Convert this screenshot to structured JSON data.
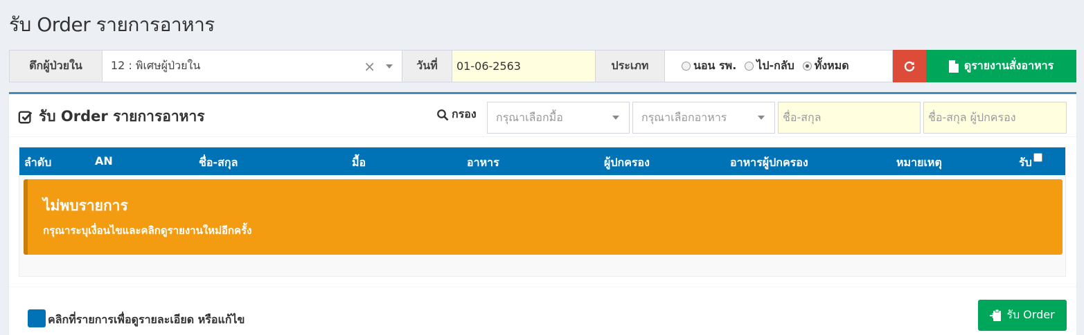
{
  "page": {
    "title": "รับ Order รายการอาหาร"
  },
  "filters": {
    "ward_label": "ตึกผู้ป่วยใน",
    "ward_value": "12 : พิเศษผู้ป่วยใน",
    "clear_symbol": "×",
    "date_label": "วันที่",
    "date_value": "01-06-2563",
    "type_label": "ประเภท",
    "type_options": [
      {
        "label": "นอน รพ.",
        "checked": false
      },
      {
        "label": "ไป-กลับ",
        "checked": false
      },
      {
        "label": "ทั้งหมด",
        "checked": true
      }
    ],
    "refresh_icon": "refresh-icon",
    "report_button": "ดูรายงานสั่งอาหาร"
  },
  "box": {
    "title": "รับ Order รายการอาหาร",
    "filter_label": "กรอง",
    "meal_placeholder": "กรุณาเลือกมื้อ",
    "food_placeholder": "กรุณาเลือกอาหาร",
    "name_placeholder": "ชื่อ-สกุล",
    "guardian_placeholder": "ชื่อ-สกุล ผู้ปกครอง"
  },
  "table": {
    "columns": [
      "ลำดับ",
      "AN",
      "ชื่อ-สกุล",
      "มื้อ",
      "อาหาร",
      "ผู้ปกครอง",
      "อาหารผู้ปกครอง",
      "หมายเหตุ",
      "รับ"
    ]
  },
  "alert": {
    "title": "ไม่พบรายการ",
    "text": "กรุณาระบุเงื่อนไขและคลิกดูรายงานใหม่อีกครั้ง"
  },
  "footer": {
    "legend": "คลิกที่รายการเพื่อดูรายละเอียด หรือแก้ไข",
    "accept_button": "รับ Order"
  },
  "colors": {
    "primary": "#0073b7",
    "success": "#00a65a",
    "danger": "#dd4b39",
    "warning": "#f39c12",
    "box_border": "#3c8dbc"
  }
}
